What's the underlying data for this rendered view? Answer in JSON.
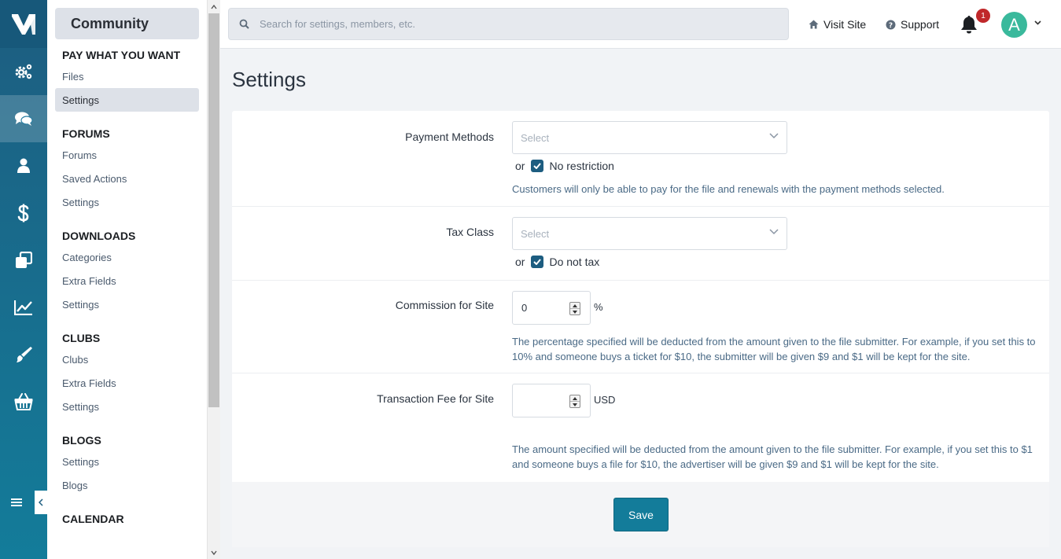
{
  "colors": {
    "sidebar_top": "#1d5d80",
    "sidebar_bottom": "#137c9a",
    "accent": "#137c9a",
    "badge": "#c0282a",
    "avatar_bg": "#3ab99c"
  },
  "iconbar": {
    "items": [
      {
        "icon": "gears-icon",
        "active": false
      },
      {
        "icon": "comments-icon",
        "active": true
      },
      {
        "icon": "user-icon",
        "active": false
      },
      {
        "icon": "dollar-icon",
        "active": false
      },
      {
        "icon": "clone-icon",
        "active": false
      },
      {
        "icon": "line-chart-icon",
        "active": false
      },
      {
        "icon": "paint-brush-icon",
        "active": false
      },
      {
        "icon": "basket-icon",
        "active": false
      }
    ]
  },
  "subnav": {
    "app_title": "Community",
    "sections": [
      {
        "title": "PAY WHAT YOU WANT",
        "items": [
          "Files",
          "Settings"
        ],
        "active_index": 1
      },
      {
        "title": "FORUMS",
        "items": [
          "Forums",
          "Saved Actions",
          "Settings"
        ]
      },
      {
        "title": "DOWNLOADS",
        "items": [
          "Categories",
          "Extra Fields",
          "Settings"
        ]
      },
      {
        "title": "CLUBS",
        "items": [
          "Clubs",
          "Extra Fields",
          "Settings"
        ]
      },
      {
        "title": "BLOGS",
        "items": [
          "Settings",
          "Blogs"
        ]
      },
      {
        "title": "CALENDAR",
        "items": []
      }
    ]
  },
  "header": {
    "search_placeholder": "Search for settings, members, etc.",
    "visit_site": "Visit Site",
    "support": "Support",
    "notification_count": "1",
    "avatar_letter": "A"
  },
  "page": {
    "title": "Settings"
  },
  "form": {
    "payment_methods": {
      "label": "Payment Methods",
      "select_placeholder": "Select",
      "or": "or",
      "checkbox_label": "No restriction",
      "checked": true,
      "description": "Customers will only be able to pay for the file and renewals with the payment methods selected."
    },
    "tax_class": {
      "label": "Tax Class",
      "select_placeholder": "Select",
      "or": "or",
      "checkbox_label": "Do not tax",
      "checked": true
    },
    "commission": {
      "label": "Commission for Site",
      "value": "0",
      "unit": "%",
      "description": "The percentage specified will be deducted from the amount given to the file submitter. For example, if you set this to 10% and someone buys a ticket for $10, the submitter will be given $9 and $1 will be kept for the site."
    },
    "transaction_fee": {
      "label": "Transaction Fee for Site",
      "value": "",
      "unit": "USD",
      "description": "The amount specified will be deducted from the amount given to the file submitter. For example, if you set this to $1 and someone buys a file for $10, the advertiser will be given $9 and $1 will be kept for the site."
    },
    "save_label": "Save"
  }
}
